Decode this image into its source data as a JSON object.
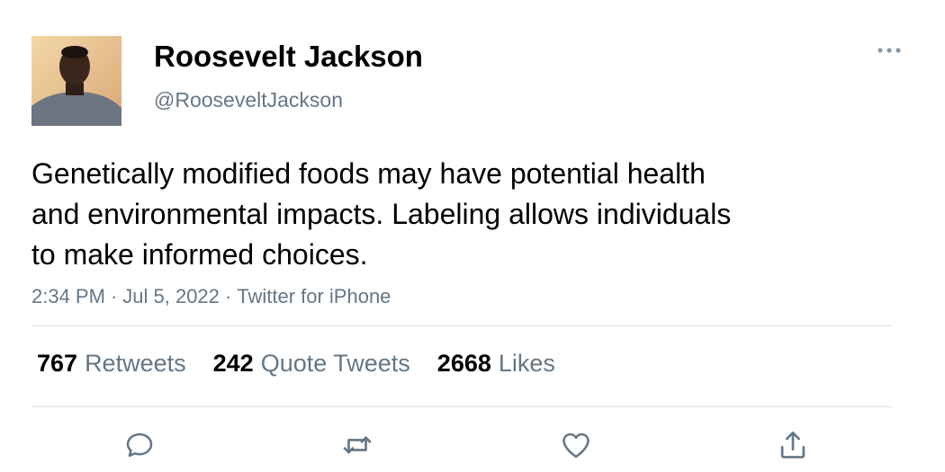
{
  "author": {
    "display_name": "Roosevelt Jackson",
    "handle": "@RooseveltJackson",
    "avatar_icon": "profile-photo"
  },
  "tweet": {
    "text_lines": [
      "Genetically modified foods may have potential health",
      "and environmental impacts. Labeling allows individuals",
      "to make informed choices."
    ],
    "time": "2:34 PM",
    "date": "Jul 5, 2022",
    "source": "Twitter for iPhone",
    "separator": "·"
  },
  "stats": {
    "retweets": {
      "count": "767",
      "label": "Retweets"
    },
    "quote_tweets": {
      "count": "242",
      "label": "Quote Tweets"
    },
    "likes": {
      "count": "2668",
      "label": "Likes"
    }
  },
  "actions": [
    "reply-icon",
    "retweet-icon",
    "like-icon",
    "share-icon"
  ],
  "colors": {
    "text_primary": "#000000",
    "text_secondary": "#657786",
    "divider": "#dadfe3",
    "icon": "#657786"
  }
}
